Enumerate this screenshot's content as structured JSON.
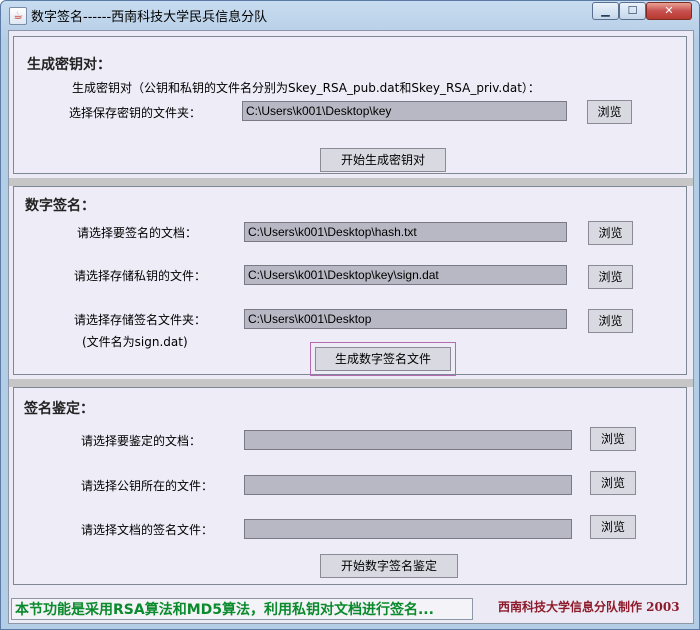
{
  "window": {
    "title": "数字签名------西南科技大学民兵信息分队",
    "icon": "java-cup-icon",
    "controls": {
      "minimize": "▁",
      "maximize": "☐",
      "close": "✕"
    }
  },
  "keygen": {
    "title": "生成密钥对：",
    "description": "生成密钥对（公钥和私钥的文件名分别为Skey_RSA_pub.dat和Skey_RSA_priv.dat）：",
    "folder_label": "选择保存密钥的文件夹：",
    "folder_value": "C:\\Users\\k001\\Desktop\\key",
    "browse_label": "浏览",
    "start_button": "开始生成密钥对"
  },
  "sign": {
    "title": "数字签名：",
    "doc_label": "请选择要签名的文档：",
    "doc_value": "C:\\Users\\k001\\Desktop\\hash.txt",
    "privkey_label": "请选择存储私钥的文件：",
    "privkey_value": "C:\\Users\\k001\\Desktop\\key\\sign.dat",
    "output_label": "请选择存储签名文件夹：",
    "output_value": "C:\\Users\\k001\\Desktop",
    "output_note": "(文件名为sign.dat)",
    "browse_label": "浏览",
    "generate_button": "生成数字签名文件"
  },
  "verify": {
    "title": "签名鉴定：",
    "doc_label": "请选择要鉴定的文档：",
    "doc_value": "",
    "pubkey_label": "请选择公钥所在的文件：",
    "pubkey_value": "",
    "sig_label": "请选择文档的签名文件：",
    "sig_value": "",
    "browse_label": "浏览",
    "start_button": "开始数字签名鉴定"
  },
  "footer": {
    "marquee": "本节功能是采用RSA算法和MD5算法，利用私钥对文档进行签名...",
    "credit": "西南科技大学信息分队制作 2003"
  },
  "colors": {
    "marquee_text": "#0a8a2c",
    "credit_text": "#8e1b2b",
    "close_button": "#c75050"
  }
}
